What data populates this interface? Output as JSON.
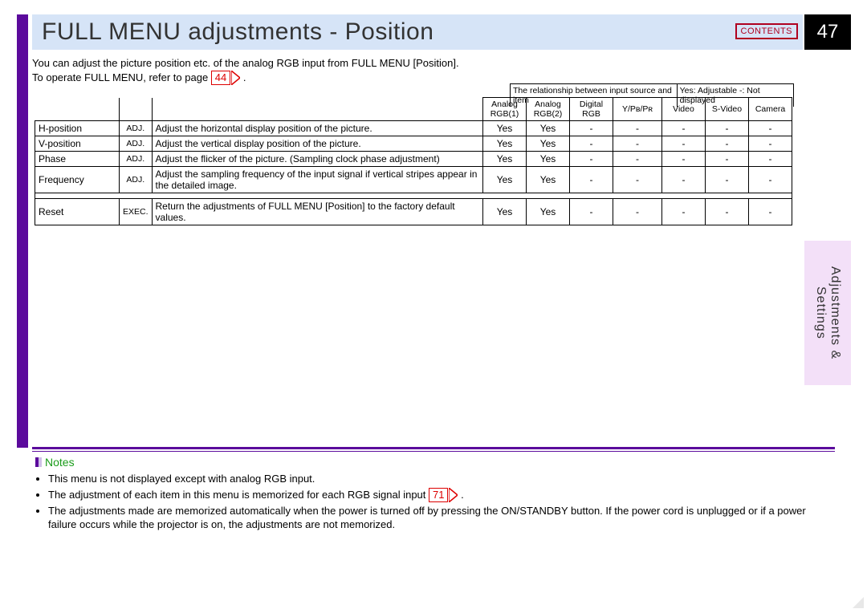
{
  "header": {
    "title": "FULL MENU adjustments - Position",
    "contents_btn": "CONTENTS",
    "page_number": "47"
  },
  "intro": {
    "line1": "You can adjust the picture position etc. of the analog RGB input from FULL MENU [Position].",
    "line2_a": "To operate FULL MENU, refer to page ",
    "line2_ref": "44",
    "line2_b": "."
  },
  "rel_header": {
    "left": "The relationship between input source and item",
    "right": "Yes: Adjustable   -: Not displayed"
  },
  "columns": {
    "src1": "Analog RGB(1)",
    "src2": "Analog RGB(2)",
    "src3": "Digital RGB",
    "src4": "Y/Pʙ/Pʀ",
    "src5": "Video",
    "src6": "S-Video",
    "src7": "Camera"
  },
  "rows": [
    {
      "item": "H-position",
      "type": "ADJ.",
      "desc": "Adjust the horizontal display position of the picture.",
      "v": [
        "Yes",
        "Yes",
        "-",
        "-",
        "-",
        "-",
        "-"
      ]
    },
    {
      "item": "V-position",
      "type": "ADJ.",
      "desc": "Adjust the vertical display position of the picture.",
      "v": [
        "Yes",
        "Yes",
        "-",
        "-",
        "-",
        "-",
        "-"
      ]
    },
    {
      "item": "Phase",
      "type": "ADJ.",
      "desc": "Adjust the flicker of the picture. (Sampling clock phase adjustment)",
      "v": [
        "Yes",
        "Yes",
        "-",
        "-",
        "-",
        "-",
        "-"
      ]
    },
    {
      "item": "Frequency",
      "type": "ADJ.",
      "desc": "Adjust the sampling frequency of the input signal if vertical stripes appear in the detailed image.",
      "v": [
        "Yes",
        "Yes",
        "-",
        "-",
        "-",
        "-",
        "-"
      ]
    },
    {
      "item": "Reset",
      "type": "EXEC.",
      "desc": "Return the adjustments of FULL MENU [Position] to the factory default values.",
      "v": [
        "Yes",
        "Yes",
        "-",
        "-",
        "-",
        "-",
        "-"
      ]
    }
  ],
  "notes": {
    "title": "Notes",
    "items": [
      {
        "pre": "This menu is not displayed except with analog RGB input.",
        "ref": null,
        "post": ""
      },
      {
        "pre": "The adjustment of each item in this menu is memorized for each RGB signal input ",
        "ref": "71",
        "post": " ."
      },
      {
        "pre": "The adjustments made are memorized automatically when the power is turned off by pressing the ON/STANDBY button. If the power cord is unplugged or if a power failure occurs while the projector is on, the adjustments are not memorized.",
        "ref": null,
        "post": ""
      }
    ]
  },
  "side_tab": {
    "line1": "Adjustments &",
    "line2": "Settings"
  }
}
